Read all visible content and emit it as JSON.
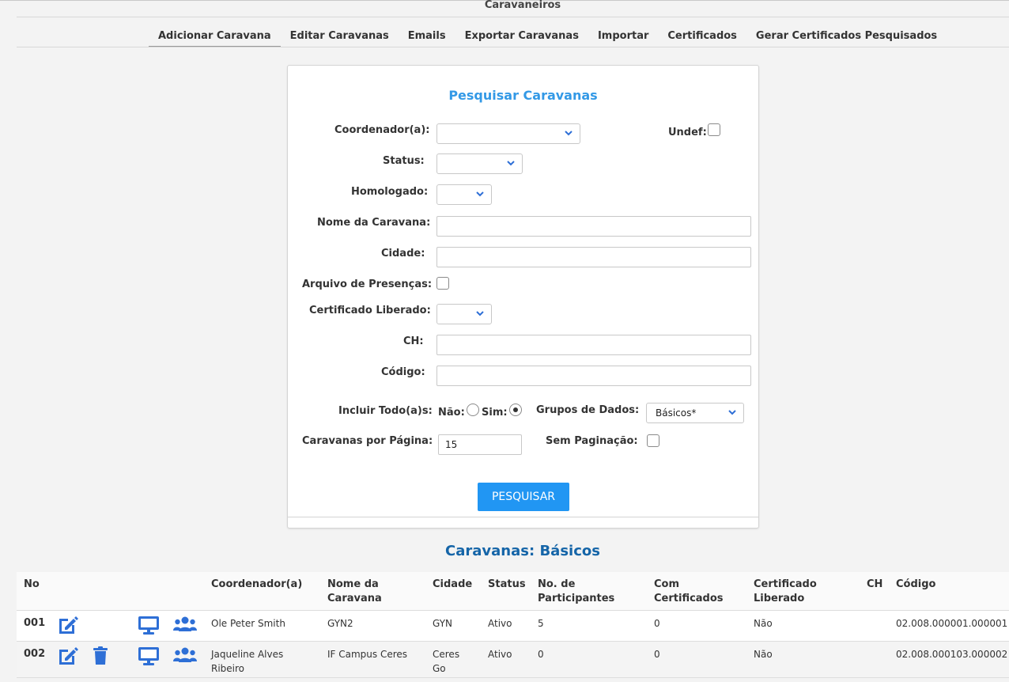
{
  "header": {
    "title": "Caravaneiros",
    "tabs": [
      {
        "label": "Adicionar Caravana"
      },
      {
        "label": "Editar Caravanas"
      },
      {
        "label": "Emails"
      },
      {
        "label": "Exportar Caravanas"
      },
      {
        "label": "Importar"
      },
      {
        "label": "Certificados"
      },
      {
        "label": "Gerar Certificados Pesquisados"
      }
    ]
  },
  "search": {
    "title": "Pesquisar Caravanas",
    "coordenador_label": "Coordenador(a):",
    "coordenador_value": "",
    "undef_label": "Undef:",
    "status_label": "Status:",
    "status_value": "",
    "homologado_label": "Homologado:",
    "homologado_value": "",
    "nome_label": "Nome da Caravana:",
    "nome_value": "",
    "cidade_label": "Cidade:",
    "cidade_value": "",
    "arquivo_label": "Arquivo de Presenças:",
    "certificado_label": "Certificado Liberado:",
    "certificado_value": "",
    "ch_label": "CH:",
    "ch_value": "",
    "codigo_label": "Código:",
    "codigo_value": "",
    "incluir_label": "Incluir Todo(a)s:",
    "nao_label": "Não:",
    "sim_label": "Sim:",
    "grupos_label": "Grupos de Dados:",
    "grupos_value": "Básicos*",
    "por_pagina_label": "Caravanas por Página:",
    "por_pagina_value": "15",
    "sem_paginacao_label": "Sem Paginação:",
    "button_label": "PESQUISAR"
  },
  "results": {
    "title": "Caravanas: Básicos",
    "columns": {
      "no": "No",
      "coordenador": "Coordenador(a)",
      "nome": [
        "Nome da",
        "Caravana"
      ],
      "cidade": "Cidade",
      "status": "Status",
      "participantes": [
        "No. de",
        "Participantes"
      ],
      "com_certificados": [
        "Com",
        "Certificados"
      ],
      "certificado_liberado": [
        "Certificado",
        "Liberado"
      ],
      "ch": "CH",
      "codigo": "Código"
    },
    "rows": [
      {
        "no": "001",
        "coordenador": [
          "Ole Peter Smith",
          ""
        ],
        "nome": "GYN2",
        "cidade": [
          "GYN",
          ""
        ],
        "status": "Ativo",
        "participantes": "5",
        "com_certificados": "0",
        "certificado_liberado": "Não",
        "ch": "",
        "codigo": "02.008.000001.000001"
      },
      {
        "no": "002",
        "coordenador": [
          "Jaqueline Alves",
          "Ribeiro"
        ],
        "nome": "IF Campus Ceres",
        "cidade": [
          "Ceres",
          "Go"
        ],
        "status": "Ativo",
        "participantes": "0",
        "com_certificados": "0",
        "certificado_liberado": "Não",
        "ch": "",
        "codigo": "02.008.000103.000002"
      }
    ]
  },
  "colors": {
    "accent": "#2196f3",
    "panel_title": "#3399e6",
    "section_title": "#1565a8",
    "icon": "#2e6fd6"
  },
  "icons": [
    "chevron-down-icon",
    "edit-icon",
    "trash-icon",
    "monitor-icon",
    "users-icon"
  ]
}
